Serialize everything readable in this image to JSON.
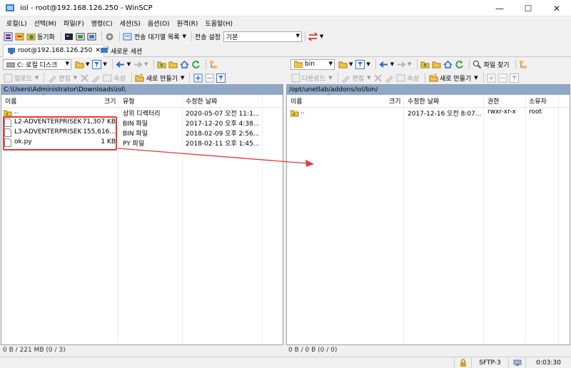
{
  "window": {
    "title": "iol - root@192.168.126.250 - WinSCP"
  },
  "menu": [
    "로컬(L)",
    "선택(M)",
    "파일(F)",
    "명령(C)",
    "세션(S)",
    "옵션(O)",
    "원격(R)",
    "도움말(H)"
  ],
  "toolbar": {
    "sync_label": "동기화",
    "queue_label": "전송 대기열 목록",
    "transfer_settings_label": "전송 설정",
    "transfer_preset": "기본"
  },
  "tabs": [
    {
      "label": "root@192.168.126.250"
    },
    {
      "label": "새로운 세션"
    }
  ],
  "left": {
    "drive": "C: 로컬 디스크",
    "upload_label": "업로드",
    "edit_label": "편집",
    "properties_label": "속성",
    "new_label": "새로 만들기",
    "path": "C:\\Users\\Administrator\\Downloads\\iol\\",
    "columns": {
      "name": "이름",
      "size": "크기",
      "type": "유형",
      "modified": "수정한 날짜"
    },
    "files": [
      {
        "name": "..",
        "size": "",
        "type": "상위 디렉터리",
        "modified": "2020-05-07  오전 11:1...",
        "icon": "folder-up-icon"
      },
      {
        "name": "L2-ADVENTERPRISEK...",
        "size": "71,307 KB",
        "type": "BIN 파일",
        "modified": "2017-12-20  오후 4:38...",
        "icon": "file-icon"
      },
      {
        "name": "L3-ADVENTERPRISEK...",
        "size": "155,616...",
        "type": "BIN 파일",
        "modified": "2018-02-09  오후 2:56...",
        "icon": "file-icon"
      },
      {
        "name": "ok.py",
        "size": "1 KB",
        "type": "PY 파일",
        "modified": "2018-02-11  오후 1:45...",
        "icon": "file-icon"
      }
    ],
    "status": "0 B / 221 MB (0 / 3)"
  },
  "right": {
    "folder": "bin",
    "find_label": "파일 찾기",
    "download_label": "다운로드",
    "edit_label": "편집",
    "properties_label": "속성",
    "new_label": "새로 만들기",
    "path": "/opt/unetlab/addons/iol/bin/",
    "columns": {
      "name": "이름",
      "size": "크기",
      "modified": "수정한 날짜",
      "rights": "권한",
      "owner": "소유자"
    },
    "files": [
      {
        "name": "..",
        "size": "",
        "modified": "2017-12-16  오전 8:07...",
        "rights": "rwxr-xr-x",
        "owner": "root",
        "icon": "folder-up-icon"
      }
    ],
    "status": "0 B / 0 B (0 / 0)"
  },
  "statusbar": {
    "protocol": "SFTP-3",
    "time": "0:03:30"
  },
  "colors": {
    "path_bar": "#8fa8c8",
    "annotation": "#e53a3a"
  }
}
